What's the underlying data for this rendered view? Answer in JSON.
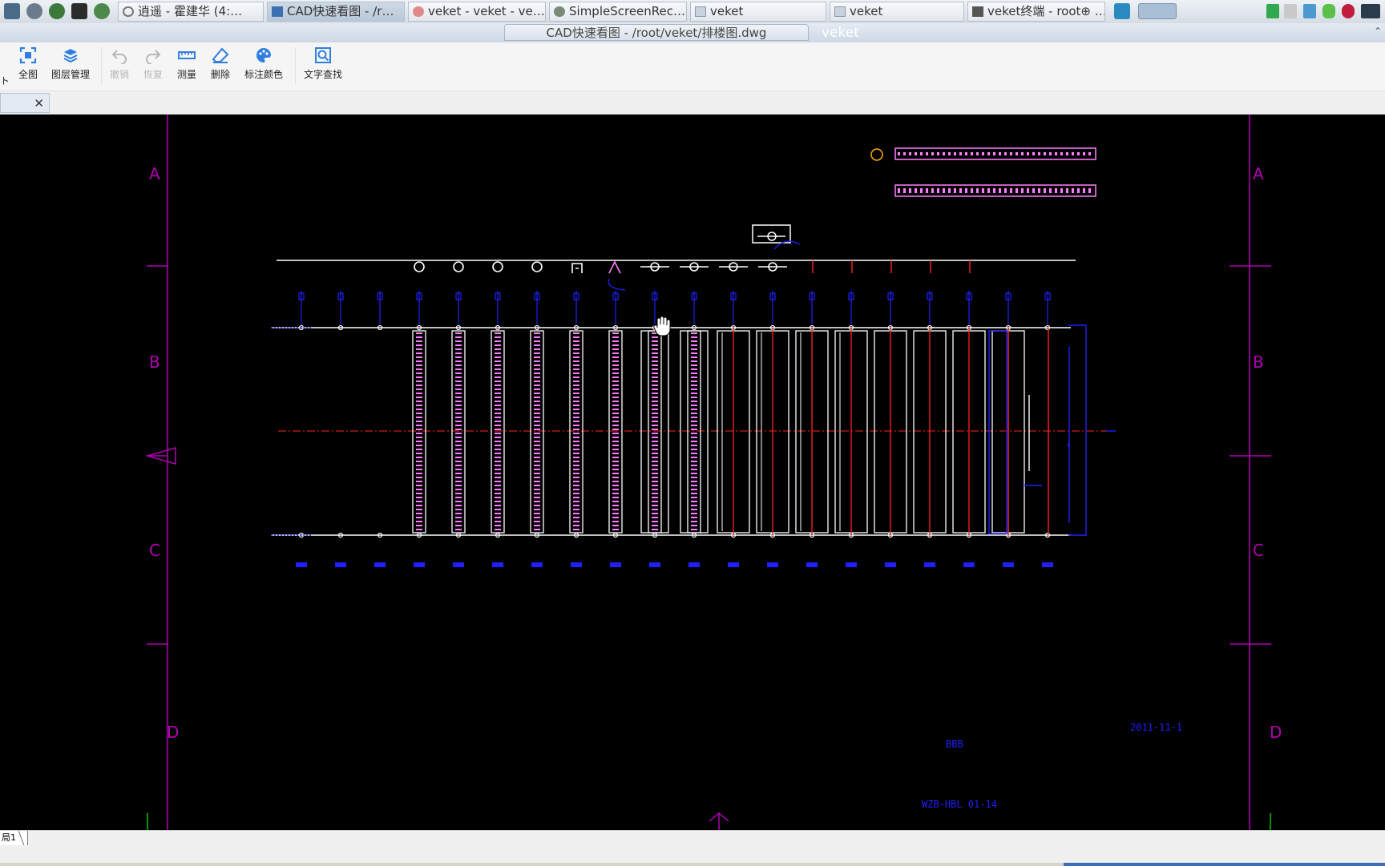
{
  "taskbar": {
    "tasks": [
      {
        "label": "逍遥 - 霍建华 (4:…",
        "icon": "music-player-icon"
      },
      {
        "label": "CAD快速看图 - /r…",
        "icon": "cad-viewer-icon",
        "active": true
      },
      {
        "label": "veket - veket - ve…",
        "icon": "browser-icon"
      },
      {
        "label": "SimpleScreenRec…",
        "icon": "screen-recorder-icon"
      },
      {
        "label": "veket",
        "icon": "folder-icon"
      },
      {
        "label": "veket",
        "icon": "folder-icon"
      },
      {
        "label": "veket终端 - root⊕ …",
        "icon": "terminal-icon"
      }
    ]
  },
  "window": {
    "tab_title": "CAD快速看图 - /root/veket/排楼图.dwg",
    "title": "veket"
  },
  "toolbar": {
    "cut_label": "ト",
    "fullview": "全图",
    "layers": "图层管理",
    "undo": "撤销",
    "redo": "恢复",
    "measure": "测量",
    "delete": "删除",
    "annotate_color": "标注颜色",
    "text_search": "文字查找"
  },
  "drawing": {
    "row_labels": [
      "A",
      "B",
      "C",
      "D"
    ],
    "date_text": "2011-11-1",
    "project_text": "WZB-HBL 01-14",
    "center_text": "BBB",
    "colors": {
      "frame": "#b000b0",
      "lines": "#ffffff",
      "annotations": "#2020ff",
      "centerline": "#ff2020",
      "panel": "#ff80ff"
    }
  },
  "status": {
    "layout_tab": "局1"
  }
}
